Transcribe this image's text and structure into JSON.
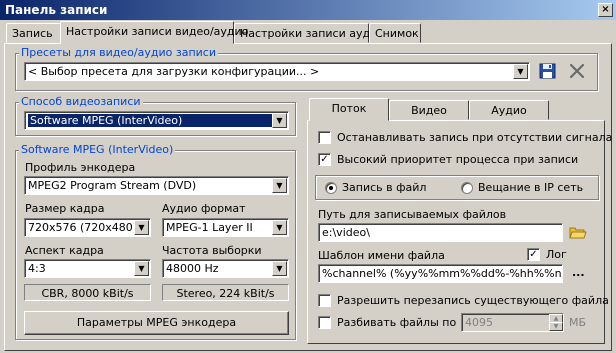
{
  "window": {
    "title": "Панель записи",
    "close": "×"
  },
  "tabs": [
    {
      "label": "Запись"
    },
    {
      "label": "Настройки записи видео/аудио"
    },
    {
      "label": "Настройки записи аудио"
    },
    {
      "label": "Снимок"
    }
  ],
  "presets": {
    "legend": "Пресеты для видео/аудио записи",
    "value": "< Выбор пресета для загрузки конфигурации... >",
    "save_icon": "floppy-disk-icon",
    "delete_icon": "close-x-icon"
  },
  "method": {
    "legend": "Способ видеозаписи",
    "value": "Software MPEG (InterVideo)"
  },
  "software": {
    "legend": "Software MPEG (InterVideo)",
    "profile_label": "Профиль энкодера",
    "profile_value": "MPEG2 Program Stream (DVD)",
    "frame_label": "Размер кадра",
    "frame_value": "720x576 (720x480)",
    "audio_label": "Аудио формат",
    "audio_value": "MPEG-1 Layer II",
    "aspect_label": "Аспект кадра",
    "aspect_value": "4:3",
    "rate_label": "Частота выборки",
    "rate_value": "48000 Hz",
    "video_info": "CBR, 8000 kBit/s",
    "audio_info": "Stereo, 224 kBit/s",
    "params_button": "Параметры MPEG энкодера"
  },
  "subtabs": [
    {
      "label": "Поток"
    },
    {
      "label": "Видео"
    },
    {
      "label": "Аудио"
    }
  ],
  "stream": {
    "stop_no_signal": {
      "label": "Останавливать запись при отсутствии сигнала",
      "checked": false
    },
    "high_priority": {
      "label": "Высокий приоритет процесса при записи",
      "checked": true
    },
    "to_file": {
      "label": "Запись в файл",
      "selected": true
    },
    "to_ip": {
      "label": "Вещание в IP сеть",
      "selected": false
    },
    "path_label": "Путь для записываемых файлов",
    "path_value": "e:\\video\\",
    "folder_icon": "folder-icon",
    "template_label": "Шаблон имени файла",
    "log_label": "Лог",
    "log_checked": true,
    "template_value": "%channel% (%yy%%mm%%dd%-%hh%%nn%",
    "ellipsis": "...",
    "overwrite": {
      "label": "Разрешить перезапись существующего файла",
      "checked": false
    },
    "split": {
      "label": "Разбивать файлы по",
      "checked": false
    },
    "split_value": "4095",
    "split_unit": "МБ"
  },
  "colors": {
    "titlebar": "#0a246a",
    "legend": "#0046d5",
    "face": "#d4d0c8"
  }
}
